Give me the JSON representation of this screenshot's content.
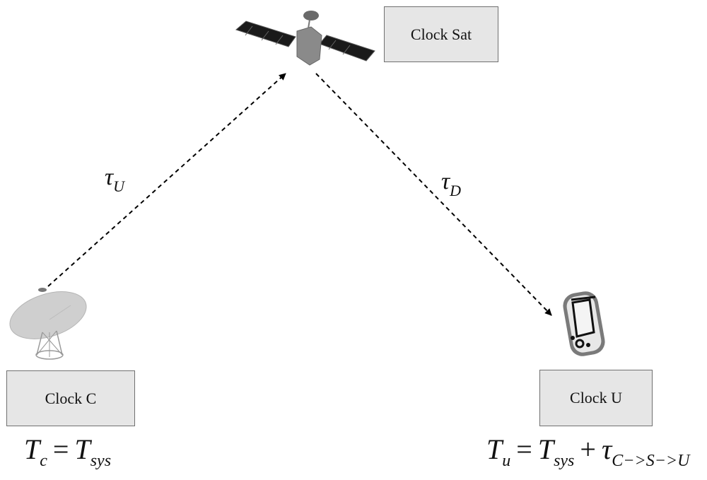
{
  "diagram": {
    "nodes": {
      "satellite": {
        "icon": "satellite-icon",
        "clock_label": "Clock Sat"
      },
      "ground_station": {
        "icon": "satellite-dish-icon",
        "clock_label": "Clock C"
      },
      "user_device": {
        "icon": "handheld-device-icon",
        "clock_label": "Clock U"
      }
    },
    "links": {
      "uplink": {
        "from": "ground_station",
        "to": "satellite",
        "symbol": "τ",
        "subscript": "U",
        "style": "dashed-arrow"
      },
      "downlink": {
        "from": "satellite",
        "to": "user_device",
        "symbol": "τ",
        "subscript": "D",
        "style": "dashed-arrow"
      }
    },
    "equations": {
      "clock_c": {
        "lhs": "T",
        "lhs_sub": "c",
        "op": "=",
        "rhs": "T",
        "rhs_sub": "sys"
      },
      "clock_u": {
        "lhs": "T",
        "lhs_sub": "u",
        "op": "=",
        "rhs": "T",
        "rhs_sub": "sys",
        "op2": "+",
        "rhs2": "τ",
        "rhs2_sub": "C−>S−>U"
      }
    }
  }
}
